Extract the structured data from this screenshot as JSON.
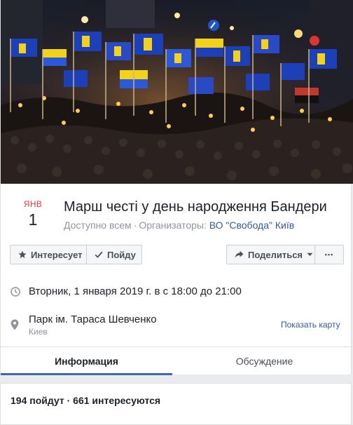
{
  "event": {
    "month": "ЯНВ",
    "day": "1",
    "title": "Марш честі у день народження Бандери",
    "visibility": "Доступно всем",
    "separator": "·",
    "organizers_label": "Организаторы:",
    "organizer_name": "ВО \"Свобода\"",
    "organizer_city": "Київ"
  },
  "actions": {
    "interested": "Интересует",
    "going": "Пойду",
    "share": "Поделиться",
    "more": "•••"
  },
  "details": {
    "datetime": "Вторник, 1 января 2019 г. в с 18:00 до 21:00",
    "place_name": "Парк ім. Тараса Шевченко",
    "place_city": "Киев",
    "show_map": "Показать карту"
  },
  "tabs": [
    "Информация",
    "Обсуждение"
  ],
  "stats": "194 пойдут · 661 интересуются",
  "colors": {
    "month_red": "#e0393e",
    "link_blue": "#365899",
    "tab_underline": "#4267b2",
    "flag_blue": "#1d3fb8",
    "flag_yellow": "#f2d21b"
  }
}
